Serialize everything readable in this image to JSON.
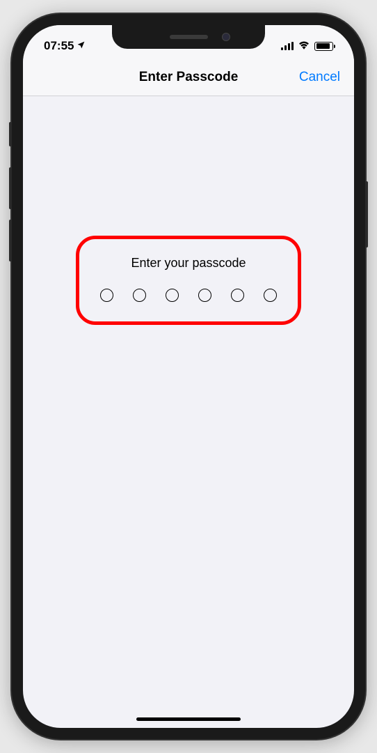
{
  "status_bar": {
    "time": "07:55"
  },
  "nav": {
    "title": "Enter Passcode",
    "cancel_label": "Cancel"
  },
  "passcode": {
    "prompt": "Enter your passcode",
    "digit_count": 6,
    "entered_count": 0
  },
  "annotation": {
    "highlight_color": "#ff0000"
  }
}
